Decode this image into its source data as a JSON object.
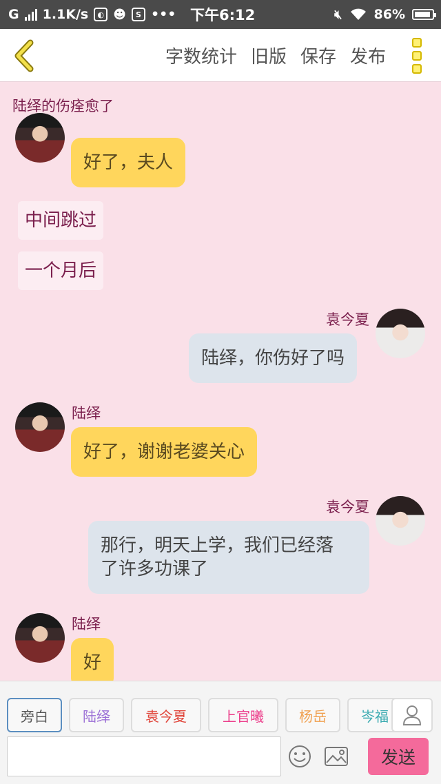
{
  "status_bar": {
    "network_label": "G",
    "speed": "1.1K/s",
    "time": "下午6:12",
    "battery": "86%"
  },
  "app_bar": {
    "actions": [
      "字数统计",
      "旧版",
      "保存",
      "发布"
    ]
  },
  "chat": {
    "title": "陆绎的伤痊愈了",
    "messages": [
      {
        "speaker": "陆绎",
        "side": "left",
        "text": "好了，夫人",
        "show_name": false
      },
      {
        "speaker": "旁白",
        "side": "narration",
        "text": "中间跳过"
      },
      {
        "speaker": "旁白",
        "side": "narration",
        "text": "一个月后"
      },
      {
        "speaker": "袁今夏",
        "side": "right",
        "text": "陆绎，你伤好了吗"
      },
      {
        "speaker": "陆绎",
        "side": "left",
        "text": "好了，谢谢老婆关心"
      },
      {
        "speaker": "袁今夏",
        "side": "right",
        "text_line1": "那行，明天上学，我们已经落",
        "text_line2": "了许多功课了"
      },
      {
        "speaker": "陆绎",
        "side": "left",
        "text": "好"
      }
    ]
  },
  "roles": [
    {
      "label": "旁白",
      "color": "#555555",
      "active": true
    },
    {
      "label": "陆绎",
      "color": "#9b6fd6"
    },
    {
      "label": "袁今夏",
      "color": "#e0453a"
    },
    {
      "label": "上官曦",
      "color": "#ec3d8a"
    },
    {
      "label": "杨岳",
      "color": "#f0a050"
    },
    {
      "label": "岑福",
      "color": "#3aaab0"
    }
  ],
  "composer": {
    "input_value": "",
    "input_placeholder": "",
    "send_label": "发送"
  },
  "colors": {
    "background": "#fae0e8",
    "left_bubble": "#ffd65c",
    "right_bubble": "#dde4ec",
    "name_color": "#7a1e4c",
    "send_button": "#f46a9b"
  }
}
